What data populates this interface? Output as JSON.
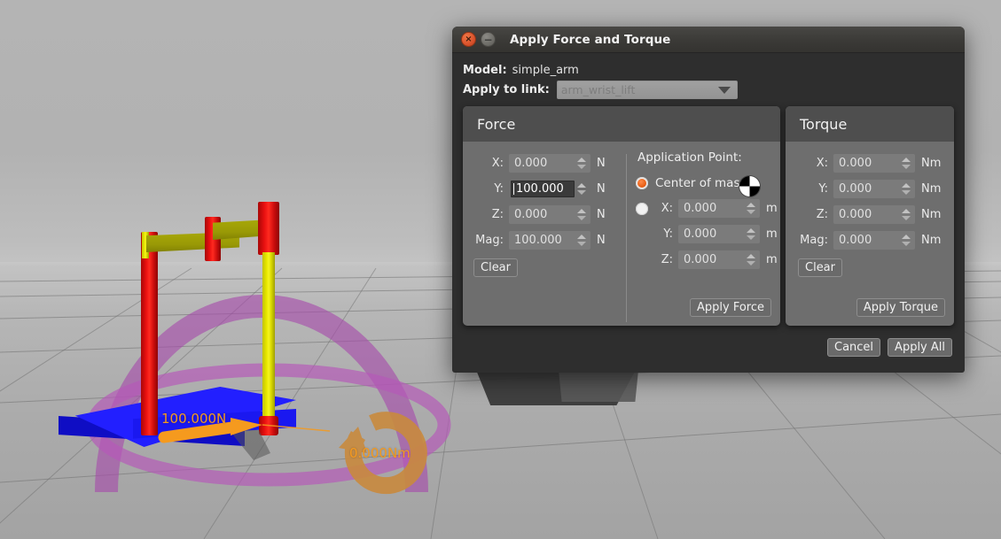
{
  "window": {
    "title": "Apply Force and Torque",
    "close_icon": "close-icon",
    "close_glyph": "×",
    "minimize_icon": "minimize-icon",
    "minimize_glyph": "−"
  },
  "header": {
    "model_label": "Model:",
    "model_value": "simple_arm",
    "link_label": "Apply to link:",
    "link_value": "arm_wrist_lift"
  },
  "force_panel": {
    "title": "Force",
    "unit": "N",
    "fields": [
      {
        "label": "X:",
        "value": "0.000",
        "focused": false
      },
      {
        "label": "Y:",
        "value": "100.000",
        "focused": true
      },
      {
        "label": "Z:",
        "value": "0.000",
        "focused": false
      },
      {
        "label": "Mag:",
        "value": "100.000",
        "focused": false
      }
    ],
    "clear_label": "Clear",
    "apply_label": "Apply Force",
    "application_point": {
      "title": "Application Point:",
      "unit": "m",
      "center_of_mass_label": "Center of mass",
      "center_of_mass_selected": true,
      "custom_selected": false,
      "fields": [
        {
          "label": "X:",
          "value": "0.000"
        },
        {
          "label": "Y:",
          "value": "0.000"
        },
        {
          "label": "Z:",
          "value": "0.000"
        }
      ]
    }
  },
  "torque_panel": {
    "title": "Torque",
    "unit": "Nm",
    "fields": [
      {
        "label": "X:",
        "value": "0.000"
      },
      {
        "label": "Y:",
        "value": "0.000"
      },
      {
        "label": "Z:",
        "value": "0.000"
      },
      {
        "label": "Mag:",
        "value": "0.000"
      }
    ],
    "clear_label": "Clear",
    "apply_label": "Apply Torque"
  },
  "footer": {
    "cancel_label": "Cancel",
    "apply_all_label": "Apply All"
  },
  "viewport": {
    "force_label": "100.000N",
    "torque_label": "0.000Nm",
    "colors": {
      "force_arrow": "#f59a1e",
      "torque_ring": "#c98a3e",
      "rotation_ring": "#b558b8",
      "link_red": "#e81010",
      "link_yellow": "#e8e800",
      "link_olive": "#9a9a06",
      "base_blue": "#1a18f0",
      "sky": "#b2b2b2",
      "ground": "#acacac"
    }
  }
}
